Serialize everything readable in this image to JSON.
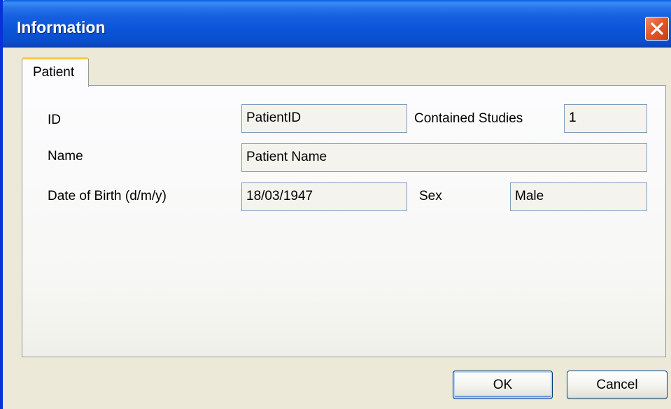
{
  "window": {
    "title": "Information"
  },
  "tabs": [
    {
      "label": "Patient",
      "selected": true
    }
  ],
  "form": {
    "id_label": "ID",
    "id_value": "PatientID",
    "contained_studies_label": "Contained Studies",
    "contained_studies_value": "1",
    "name_label": "Name",
    "name_value": "Patient Name",
    "dob_label": "Date of Birth (d/m/y)",
    "dob_value": "18/03/1947",
    "sex_label": "Sex",
    "sex_value": "Male"
  },
  "buttons": {
    "ok_label": "OK",
    "cancel_label": "Cancel"
  },
  "colors": {
    "titlebar": "#0b55d8",
    "close_button": "#e35a2c",
    "dialog_background": "#ece9d8",
    "tab_highlight": "#ffc83c",
    "field_border": "#7f9db9"
  },
  "icons": {
    "close": "close-icon"
  }
}
